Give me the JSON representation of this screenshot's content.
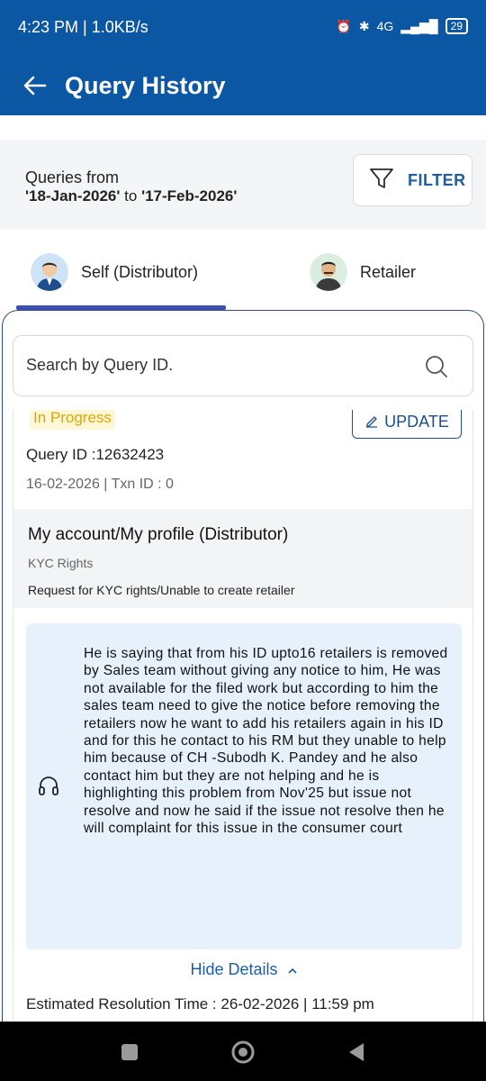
{
  "status_bar": {
    "time": "4:23 PM | 1.0KB/s",
    "network": "4G",
    "battery": "29"
  },
  "header": {
    "title": "Query History"
  },
  "filter": {
    "queries_label": "Queries from",
    "date_from": "'18-Jan-2026'",
    "date_sep": " to ",
    "date_to": "'17-Feb-2026'",
    "button_label": "FILTER"
  },
  "tabs": [
    {
      "label": "Self (Distributor)",
      "selected": true
    },
    {
      "label": "Retailer",
      "selected": false
    }
  ],
  "search": {
    "placeholder": "Search by Query ID."
  },
  "query": {
    "status": "In Progress",
    "update_label": "UPDATE",
    "query_id": "Query ID :12632423",
    "meta": "16-02-2026 | Txn ID : 0",
    "category_title": "My account/My profile (Distributor)",
    "category_sub": "KYC Rights",
    "category_desc": "Request for KYC rights/Unable to create retailer",
    "remark": "He is saying that from his ID upto16 retailers is removed by Sales team without giving any notice to him, He was not available for the filed work but according to him the sales team need to give the notice before removing the retailers now he want to add his retailers again in his ID and for this he contact to his RM but they unable to help him because of CH -Subodh K. Pandey and he also contact him but they are not helping and he is highlighting this problem from Nov'25 but issue not resolve and now he said if the issue not resolve then he will complaint for this issue in the consumer court",
    "hide_details": "Hide Details",
    "resolution": "Estimated Resolution Time : 26-02-2026 | 11:59 pm"
  },
  "colors": {
    "brand_blue": "#0b57a4",
    "status_yellow": "#e1a600",
    "remark_bg": "#e6f1fb"
  }
}
